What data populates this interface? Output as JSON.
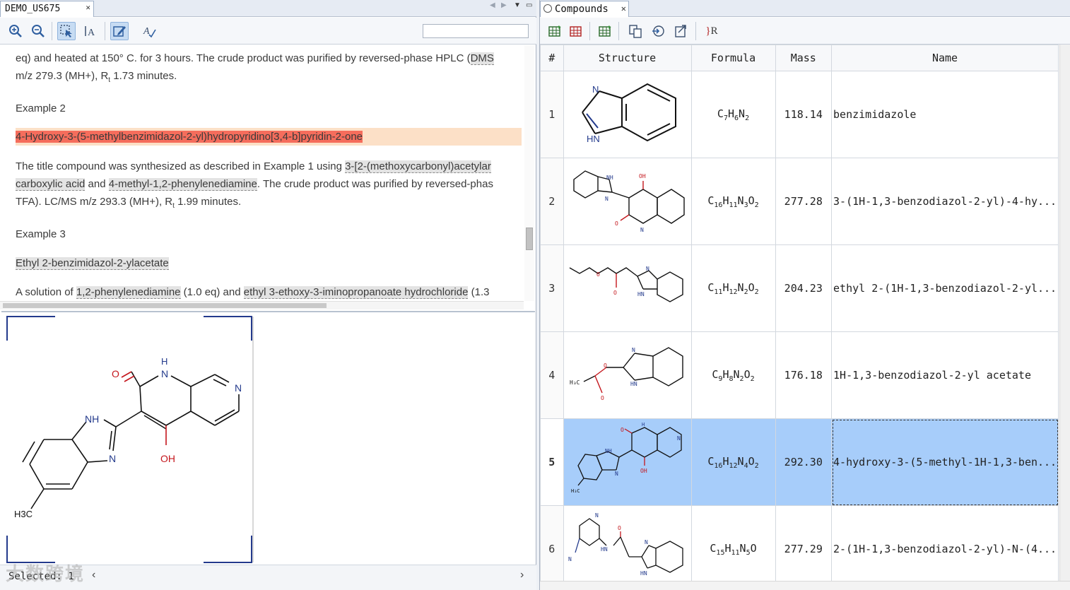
{
  "left_panel": {
    "tab": {
      "title": "DEMO_US675",
      "close": "✕"
    },
    "search": {
      "value": ""
    },
    "document": {
      "line1": "eq) and heated at 150° C. for 3 hours. The crude product was purified by reversed-phase HPLC (",
      "line1_hl": "DMS",
      "line2_a": "m/z 279.3 (MH+), R",
      "line2_sub": "t",
      "line2_b": " 1.73 minutes.",
      "example2": "Example 2",
      "example2_title": "4-Hydroxy-3-(5-methylbenzimidazol-2-yl)hydropyridino[3,4-b]pyridin-2-one",
      "para2_l1_a": "The title compound was synthesized as described in Example 1 using ",
      "para2_l1_hl": "3-[2-(methoxycarbonyl)acetylar",
      "para2_l2_hl1": "carboxylic acid",
      "para2_l2_mid": " and ",
      "para2_l2_hl2": "4-methyl-1,2-phenylenediamine",
      "para2_l2_b": ". The crude product was purified by reversed-phas",
      "para2_l3_a": "TFA). LC/MS m/z 293.3 (MH+), R",
      "para2_l3_sub": "t",
      "para2_l3_b": " 1.99 minutes.",
      "example3": "Example 3",
      "example3_title": "Ethyl 2-benzimidazol-2-ylacetate",
      "para3_a": "A solution of ",
      "para3_hl1": "1,2-phenylenediamine",
      "para3_mid": " (1.0 eq) and ",
      "para3_hl2": "ethyl 3-ethoxy-3-iminopropanoate hydrochloride",
      "para3_b": " (1.3"
    },
    "structure_labels": {
      "o": "O",
      "h": "H",
      "n1": "N",
      "n2": "N",
      "nh": "NH",
      "n3": "N",
      "oh": "OH",
      "h3c": "H3C"
    },
    "status": {
      "text": "Selected: 1"
    }
  },
  "right_panel": {
    "tab": {
      "title": "Compounds",
      "close": "✕"
    },
    "toolbar_r_label": "R",
    "columns": {
      "idx": "#",
      "structure": "Structure",
      "formula": "Formula",
      "mass": "Mass",
      "name": "Name"
    },
    "rows": [
      {
        "idx": "1",
        "formula": "C7H6N2",
        "mass": "118.14",
        "name": "benzimidazole"
      },
      {
        "idx": "2",
        "formula": "C16H11N3O2",
        "mass": "277.28",
        "name": "3-(1H-1,3-benzodiazol-2-yl)-4-hy..."
      },
      {
        "idx": "3",
        "formula": "C11H12N2O2",
        "mass": "204.23",
        "name": "ethyl 2-(1H-1,3-benzodiazol-2-yl..."
      },
      {
        "idx": "4",
        "formula": "C9H8N2O2",
        "mass": "176.18",
        "name": "1H-1,3-benzodiazol-2-yl acetate"
      },
      {
        "idx": "5",
        "formula": "C16H12N4O2",
        "mass": "292.30",
        "name": "4-hydroxy-3-(5-methyl-1H-1,3-ben..."
      },
      {
        "idx": "6",
        "formula": "C15H11N5O",
        "mass": "277.29",
        "name": "2-(1H-1,3-benzodiazol-2-yl)-N-(4..."
      }
    ],
    "selected_row": "5"
  },
  "colors": {
    "selection": "#a7cdfa",
    "highlight_red": "#f56d5c",
    "highlight_peach": "#fce0c7"
  },
  "watermark": "大数跨境"
}
